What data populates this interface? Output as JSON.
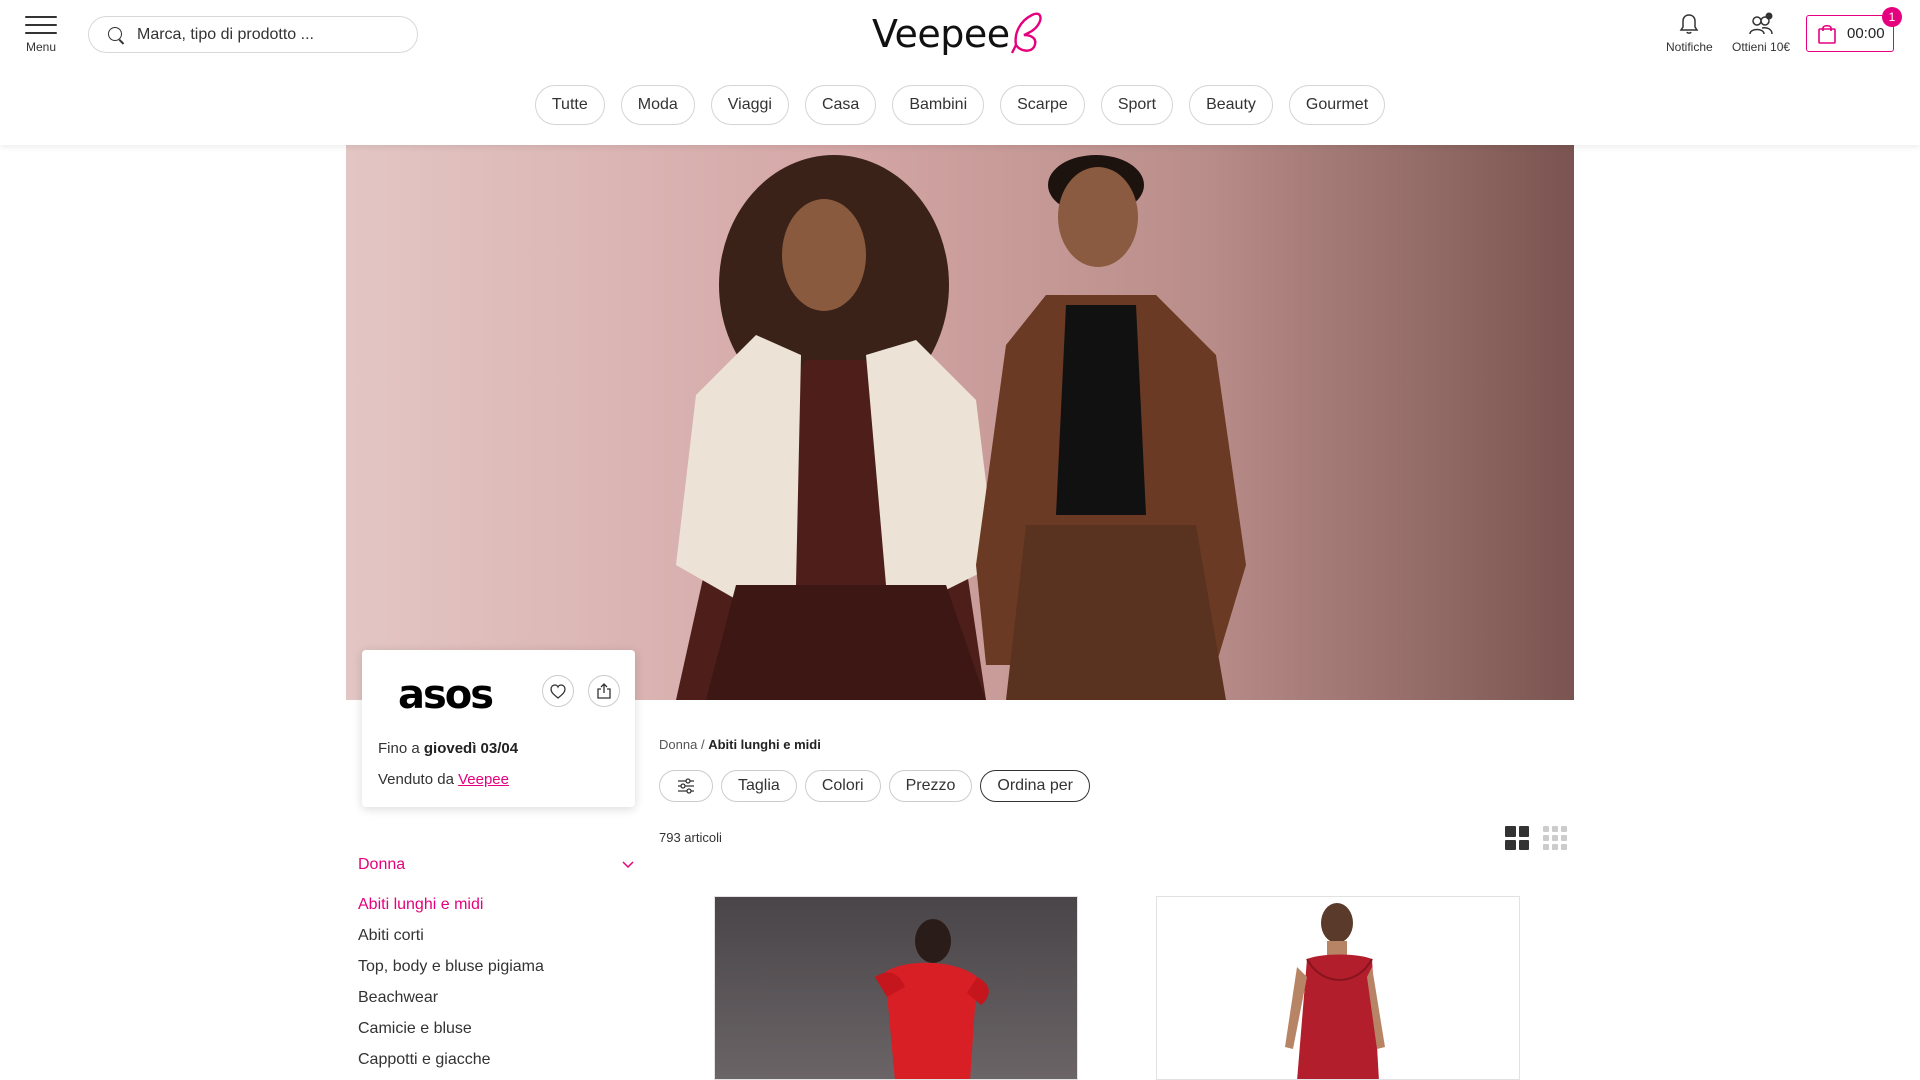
{
  "header": {
    "menu_label": "Menu",
    "search_placeholder": "Marca, tipo di prodotto ...",
    "logo_text": "Veepee",
    "notifications_label": "Notifiche",
    "referral_label": "Ottieni 10€",
    "cart_time": "00:00",
    "cart_count": "1"
  },
  "categories": [
    "Tutte",
    "Moda",
    "Viaggi",
    "Casa",
    "Bambini",
    "Scarpe",
    "Sport",
    "Beauty",
    "Gourmet"
  ],
  "brand_card": {
    "brand_logo": "asos",
    "until_prefix": "Fino a",
    "until_date": "giovedì 03/04",
    "sold_by_prefix": "Venduto da",
    "sold_by_link": "Veepee"
  },
  "sidebar": {
    "section": "Donna",
    "items": [
      {
        "label": "Abiti lunghi e midi",
        "active": true
      },
      {
        "label": "Abiti corti"
      },
      {
        "label": "Top, body e bluse pigiama"
      },
      {
        "label": "Beachwear"
      },
      {
        "label": "Camicie e bluse"
      },
      {
        "label": "Cappotti e giacche"
      }
    ]
  },
  "breadcrumb": {
    "parent": "Donna",
    "separator": "/",
    "current": "Abiti lunghi e midi"
  },
  "filters": {
    "size": "Taglia",
    "colors": "Colori",
    "price": "Prezzo",
    "sort": "Ordina per"
  },
  "results_count": "793 articoli",
  "colors": {
    "accent": "#e5007e",
    "text": "#222222"
  }
}
